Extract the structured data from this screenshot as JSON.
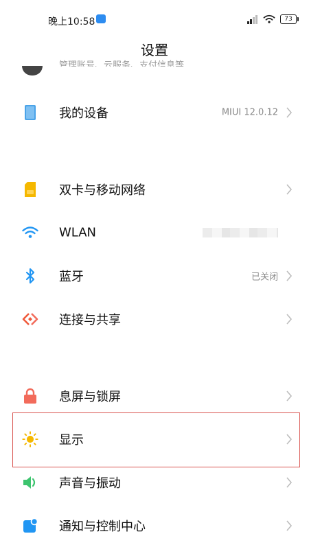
{
  "status_bar": {
    "time": "晚上10:58",
    "battery": "73",
    "icons": [
      "cloud-icon",
      "signal-icon",
      "wifi-icon",
      "battery-icon"
    ]
  },
  "header": {
    "title": "设置"
  },
  "account_row": {
    "subtitle": "管理账号、云服务、支付信息等"
  },
  "items": [
    {
      "id": "my-device",
      "label": "我的设备",
      "value": "MIUI 12.0.12",
      "icon": "device-icon",
      "color": "#4aa3e8"
    },
    {
      "id": "dual-sim",
      "label": "双卡与移动网络",
      "value": "",
      "icon": "sim-card-icon",
      "color": "#f5b800"
    },
    {
      "id": "wlan",
      "label": "WLAN",
      "value": "",
      "icon": "wifi-icon",
      "color": "#2196f3"
    },
    {
      "id": "bluetooth",
      "label": "蓝牙",
      "value": "已关闭",
      "icon": "bluetooth-icon",
      "color": "#2196f3"
    },
    {
      "id": "connection-sharing",
      "label": "连接与共享",
      "value": "",
      "icon": "connection-sharing-icon",
      "color": "#f05a3b"
    },
    {
      "id": "lock-screen",
      "label": "息屏与锁屏",
      "value": "",
      "icon": "lock-icon",
      "color": "#f26b5b"
    },
    {
      "id": "display",
      "label": "显示",
      "value": "",
      "icon": "sun-icon",
      "color": "#f5b800"
    },
    {
      "id": "sound",
      "label": "声音与振动",
      "value": "",
      "icon": "speaker-icon",
      "color": "#3cc46e"
    },
    {
      "id": "notifications",
      "label": "通知与控制中心",
      "value": "",
      "icon": "notification-icon",
      "color": "#2196f3"
    }
  ],
  "highlight_color": "#d9534f"
}
